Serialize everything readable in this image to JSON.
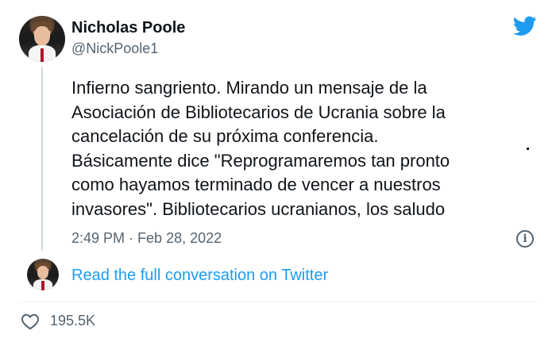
{
  "author": {
    "name": "Nicholas Poole",
    "handle": "@NickPoole1"
  },
  "tweet": {
    "lines": [
      "Infierno sangriento. Mirando un mensaje de la",
      "Asociación de Bibliotecarios de Ucrania sobre la",
      "cancelación de su próxima conferencia.",
      "Básicamente dice \"Reprogramaremos tan pronto",
      "como hayamos terminado de vencer a nuestros",
      "invasores\". Bibliotecarios ucranianos, los saludo"
    ],
    "time": "2:49 PM",
    "separator": " · ",
    "date": "Feb 28, 2022"
  },
  "footer": {
    "read_more": "Read the full conversation on Twitter",
    "like_count": "195.5K"
  },
  "icons": {
    "brand": "twitter-bird-icon",
    "info": "info-icon",
    "like": "heart-icon"
  },
  "colors": {
    "brand": "#1d9bf0",
    "text": "#0f1419",
    "muted": "#536471"
  }
}
